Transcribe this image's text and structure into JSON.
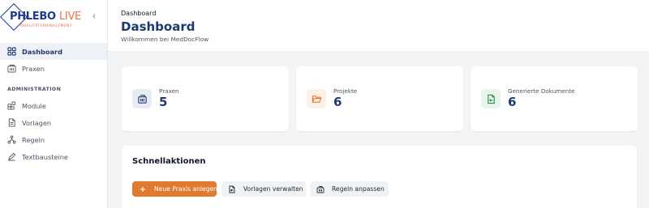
{
  "brand": {
    "name_main": "PHLEBO",
    "name_accent": "LIVE",
    "tagline": "QUALITÄTSMANAGEMENT",
    "collapse_glyph": "‹"
  },
  "sidebar": {
    "items": [
      {
        "label": "Dashboard",
        "icon": "dashboard-grid-icon",
        "active": true
      },
      {
        "label": "Praxen",
        "icon": "building-icon",
        "active": false
      }
    ],
    "admin_section_label": "ADMINISTRATION",
    "admin_items": [
      {
        "label": "Module",
        "icon": "modules-icon"
      },
      {
        "label": "Vorlagen",
        "icon": "document-icon"
      },
      {
        "label": "Regeln",
        "icon": "rules-tree-icon"
      },
      {
        "label": "Textbausteine",
        "icon": "pen-icon"
      }
    ]
  },
  "header": {
    "breadcrumb": "Dashboard",
    "title": "Dashboard",
    "subtitle": "Willkommen bei MedDocFlow"
  },
  "stats": [
    {
      "label": "Praxen",
      "value": "5",
      "icon": "building-icon",
      "icon_bg": "#e7ecf4",
      "icon_color": "#1e3a6e"
    },
    {
      "label": "Projekte",
      "value": "6",
      "icon": "folder-open-icon",
      "icon_bg": "#fdf0e4",
      "icon_color": "#e07a2f"
    },
    {
      "label": "Generierte Dokumente",
      "value": "6",
      "icon": "file-export-icon",
      "icon_bg": "#e6f4ea",
      "icon_color": "#2f8a4c"
    }
  ],
  "quick_actions": {
    "title": "Schnellaktionen",
    "buttons": [
      {
        "label": "Neue Praxis anlegen",
        "icon": "plus-icon",
        "style": "primary"
      },
      {
        "label": "Vorlagen verwalten",
        "icon": "file-import-icon",
        "style": "secondary"
      },
      {
        "label": "Regeln anpassen",
        "icon": "building-icon",
        "style": "secondary"
      }
    ]
  },
  "colors": {
    "brand_navy": "#1e3a6e",
    "accent_orange": "#e07a2f",
    "background": "#f3f4f6"
  }
}
